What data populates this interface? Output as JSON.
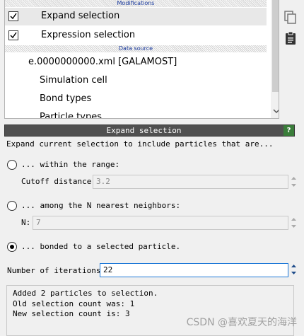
{
  "pipeline": {
    "modifications_header": "Modifications",
    "modifiers": [
      {
        "label": "Expand selection",
        "checked": true
      },
      {
        "label": "Expression selection",
        "checked": true
      }
    ],
    "data_source_header": "Data source",
    "source_file": "e.0000000000.xml [GALAMOST]",
    "items": [
      "Simulation cell",
      "Bond types",
      "Particle types"
    ]
  },
  "side_icons": [
    "copy-icon",
    "clipboard-icon"
  ],
  "panel": {
    "title": "Expand selection",
    "help": "?",
    "description": "Expand current selection to include particles that are...",
    "options": {
      "range_label": "... within the range:",
      "cutoff_label": "Cutoff distance:",
      "cutoff_value": "3.2",
      "nearest_label": "... among the N nearest neighbors:",
      "n_label": "N:",
      "n_value": "7",
      "bonded_label": "... bonded to a selected particle.",
      "selected": "bonded"
    },
    "iterations_label": "Number of iterations:",
    "iterations_value": "22",
    "status_lines": [
      "Added 2 particles to selection.",
      "Old selection count was: 1",
      "New selection count is: 3"
    ]
  },
  "watermark": "CSDN @喜欢夏天的海洋"
}
